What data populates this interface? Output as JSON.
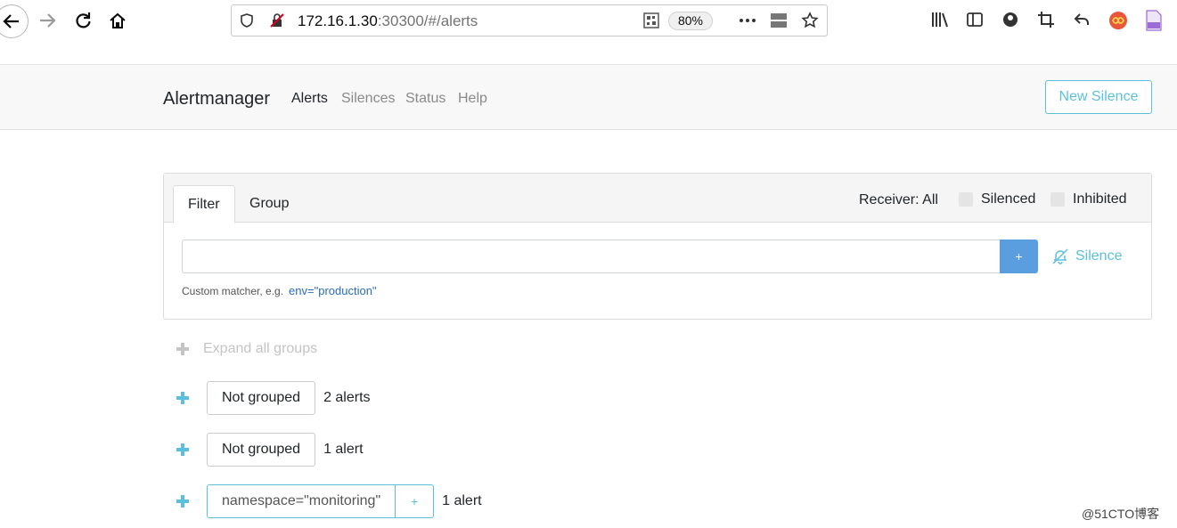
{
  "browser": {
    "url_host": "172.16.1.30",
    "url_rest": ":30300/#/alerts",
    "zoom": "80%"
  },
  "app": {
    "brand": "Alertmanager",
    "nav": [
      {
        "label": "Alerts",
        "active": true
      },
      {
        "label": "Silences",
        "active": false
      },
      {
        "label": "Status",
        "active": false
      },
      {
        "label": "Help",
        "active": false
      }
    ],
    "new_silence": "New Silence"
  },
  "filter_card": {
    "tabs": [
      {
        "label": "Filter",
        "active": true
      },
      {
        "label": "Group",
        "active": false
      }
    ],
    "receiver": "Receiver: All",
    "silenced_label": "Silenced",
    "inhibited_label": "Inhibited",
    "input_value": "",
    "add_label": "+",
    "silence_label": "Silence",
    "hint": "Custom matcher, e.g.",
    "hint_example": "env=\"production\""
  },
  "groups": {
    "expand_all": "Expand all groups",
    "items": [
      {
        "label": "Not grouped",
        "count": "2 alerts"
      },
      {
        "label": "Not grouped",
        "count": "1 alert"
      },
      {
        "label": "namespace=\"monitoring\"",
        "add": "+",
        "count": "1 alert"
      }
    ]
  },
  "watermark": "@51CTO博客",
  "colors": {
    "accent": "#5bc0de",
    "primary_button": "#5b9ee0"
  }
}
